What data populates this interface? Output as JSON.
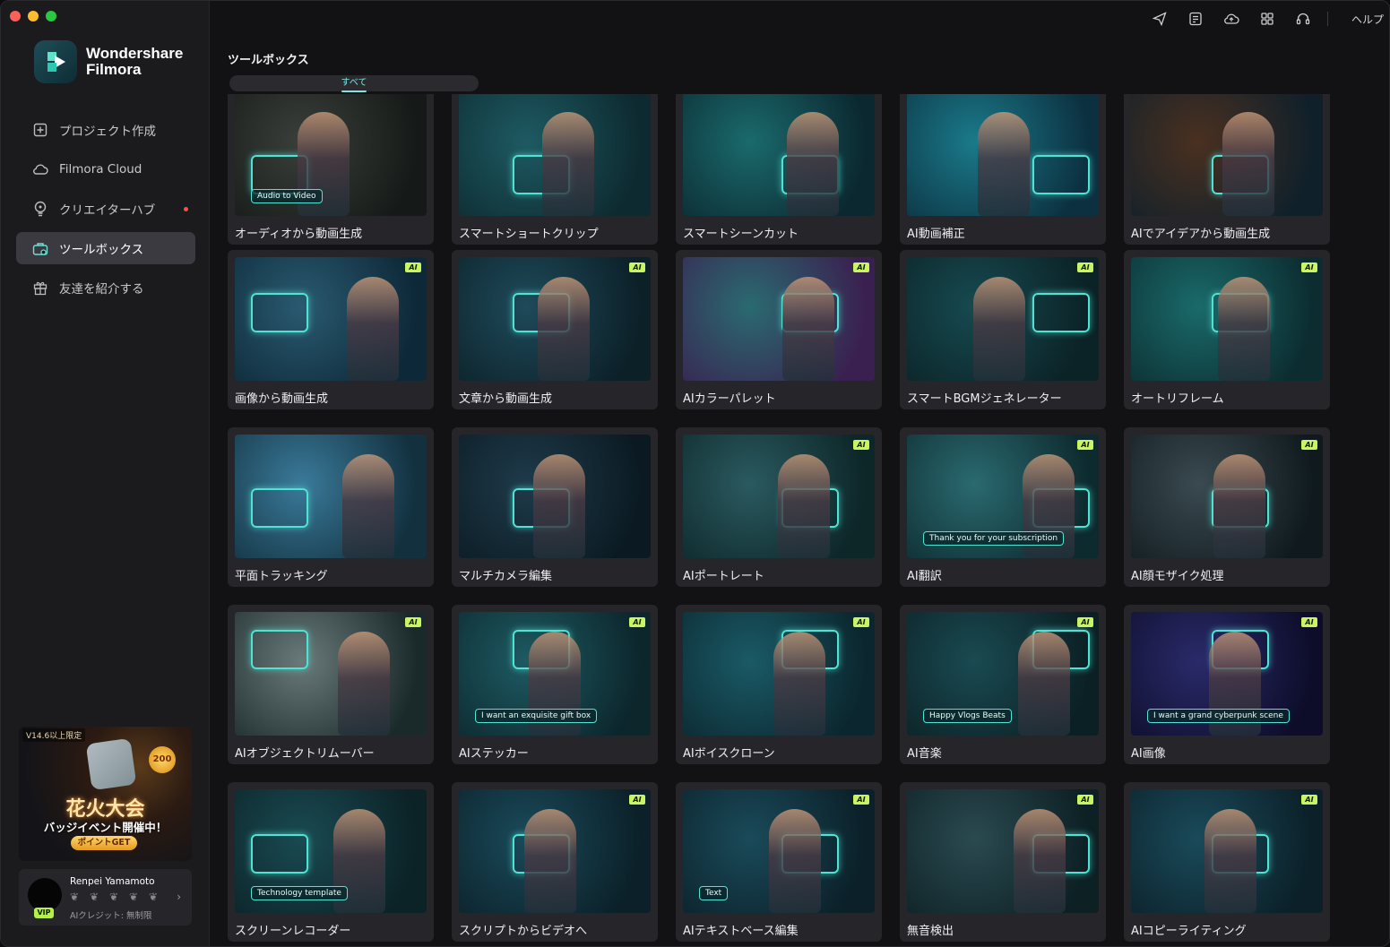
{
  "window": {
    "traffic_lights": [
      "close",
      "minimize",
      "zoom"
    ]
  },
  "sidebar": {
    "brand": {
      "line1": "Wondershare",
      "line2": "Filmora"
    },
    "items": [
      {
        "name": "sidebar-item-project",
        "label": "プロジェクト作成",
        "icon": "plus-square-icon",
        "active": false
      },
      {
        "name": "sidebar-item-cloud",
        "label": "Filmora Cloud",
        "icon": "cloud-icon",
        "active": false
      },
      {
        "name": "sidebar-item-creator-hub",
        "label": "クリエイターハブ",
        "icon": "bulb-icon",
        "active": false,
        "dot": true
      },
      {
        "name": "sidebar-item-toolbox",
        "label": "ツールボックス",
        "icon": "toolbox-icon",
        "active": true
      },
      {
        "name": "sidebar-item-refer",
        "label": "友達を紹介する",
        "icon": "gift-icon",
        "active": false
      }
    ],
    "promo": {
      "tag": "V14.6以上限定",
      "title": "花火大会",
      "subtitle": "バッジイベント開催中！",
      "button": "ポイントGET",
      "badge": "200"
    },
    "user": {
      "name": "Renpei Yamamoto",
      "vip": "VIP",
      "credit": "AIクレジット: 無制限"
    }
  },
  "topbar": {
    "icons": [
      "send-icon",
      "notes-icon",
      "cloud-upload-icon",
      "grid-icon",
      "headset-icon"
    ],
    "help": "ヘルプ"
  },
  "main": {
    "title": "ツールボックス",
    "filter": "すべて",
    "ai_badge": "AI",
    "cards": [
      {
        "label": "オーディオから動画生成",
        "ai": false,
        "caption": "Audio to Video",
        "bg": [
          "#3a3f3a",
          "#151a18"
        ]
      },
      {
        "label": "スマートショートクリップ",
        "ai": false,
        "caption": "",
        "bg": [
          "#1e5a62",
          "#0d2a30"
        ]
      },
      {
        "label": "スマートシーンカット",
        "ai": false,
        "caption": "",
        "bg": [
          "#1a6a6c",
          "#0b2830"
        ]
      },
      {
        "label": "AI動画補正",
        "ai": false,
        "caption": "",
        "bg": [
          "#1a7a8a",
          "#0c3040"
        ]
      },
      {
        "label": "AIでアイデアから動画生成",
        "ai": false,
        "caption": "",
        "bg": [
          "#4a3020",
          "#10202a"
        ]
      },
      {
        "label": "画像から動画生成",
        "ai": true,
        "caption": "",
        "bg": [
          "#2a5a70",
          "#0d2838"
        ]
      },
      {
        "label": "文章から動画生成",
        "ai": true,
        "caption": "",
        "bg": [
          "#1e4a5a",
          "#0c2028"
        ]
      },
      {
        "label": "AIカラーパレット",
        "ai": true,
        "caption": "",
        "bg": [
          "#2a6a70",
          "#3a2050"
        ]
      },
      {
        "label": "スマートBGMジェネレーター",
        "ai": true,
        "caption": "",
        "bg": [
          "#164a50",
          "#0b2226"
        ]
      },
      {
        "label": "オートリフレーム",
        "ai": true,
        "caption": "",
        "bg": [
          "#1a6a6a",
          "#0c2c30"
        ]
      },
      {
        "label": "平面トラッキング",
        "ai": false,
        "caption": "",
        "bg": [
          "#3a7a9a",
          "#12303e"
        ]
      },
      {
        "label": "マルチカメラ編集",
        "ai": false,
        "caption": "",
        "bg": [
          "#1e3a4a",
          "#0b1a22"
        ]
      },
      {
        "label": "AIポートレート",
        "ai": true,
        "caption": "",
        "bg": [
          "#2a5a60",
          "#0d2628"
        ]
      },
      {
        "label": "AI翻訳",
        "ai": true,
        "caption": "Thank you for your subscription",
        "bg": [
          "#2a6a70",
          "#0d2a2e"
        ]
      },
      {
        "label": "AI顔モザイク処理",
        "ai": true,
        "caption": "",
        "bg": [
          "#3a4a50",
          "#101a1e"
        ]
      },
      {
        "label": "AIオブジェクトリムーバー",
        "ai": true,
        "caption": "",
        "bg": [
          "#6a7a7a",
          "#1a2a2a"
        ]
      },
      {
        "label": "AIステッカー",
        "ai": true,
        "caption": "I want an exquisite gift box",
        "bg": [
          "#1e5a62",
          "#0c262c"
        ]
      },
      {
        "label": "AIボイスクローン",
        "ai": true,
        "caption": "",
        "bg": [
          "#1a5a66",
          "#0b262e"
        ]
      },
      {
        "label": "AI音楽",
        "ai": true,
        "caption": "Happy Vlogs Beats",
        "bg": [
          "#1a4a52",
          "#0b2024"
        ]
      },
      {
        "label": "AI画像",
        "ai": true,
        "caption": "I want a grand cyberpunk scene",
        "bg": [
          "#2a2a6a",
          "#0d0d2a"
        ]
      },
      {
        "label": "スクリーンレコーダー",
        "ai": false,
        "caption": "Technology template",
        "bg": [
          "#1a4a52",
          "#0b2226"
        ]
      },
      {
        "label": "スクリプトからビデオへ",
        "ai": true,
        "caption": "",
        "bg": [
          "#1a4a5a",
          "#0b2028"
        ]
      },
      {
        "label": "AIテキストベース編集",
        "ai": true,
        "caption": "Text",
        "bg": [
          "#1a4a5a",
          "#0b2028"
        ]
      },
      {
        "label": "無音検出",
        "ai": true,
        "caption": "",
        "bg": [
          "#2a4a50",
          "#0d2024"
        ]
      },
      {
        "label": "AIコピーライティング",
        "ai": true,
        "caption": "",
        "bg": [
          "#1a4a5a",
          "#0b2028"
        ]
      }
    ]
  }
}
